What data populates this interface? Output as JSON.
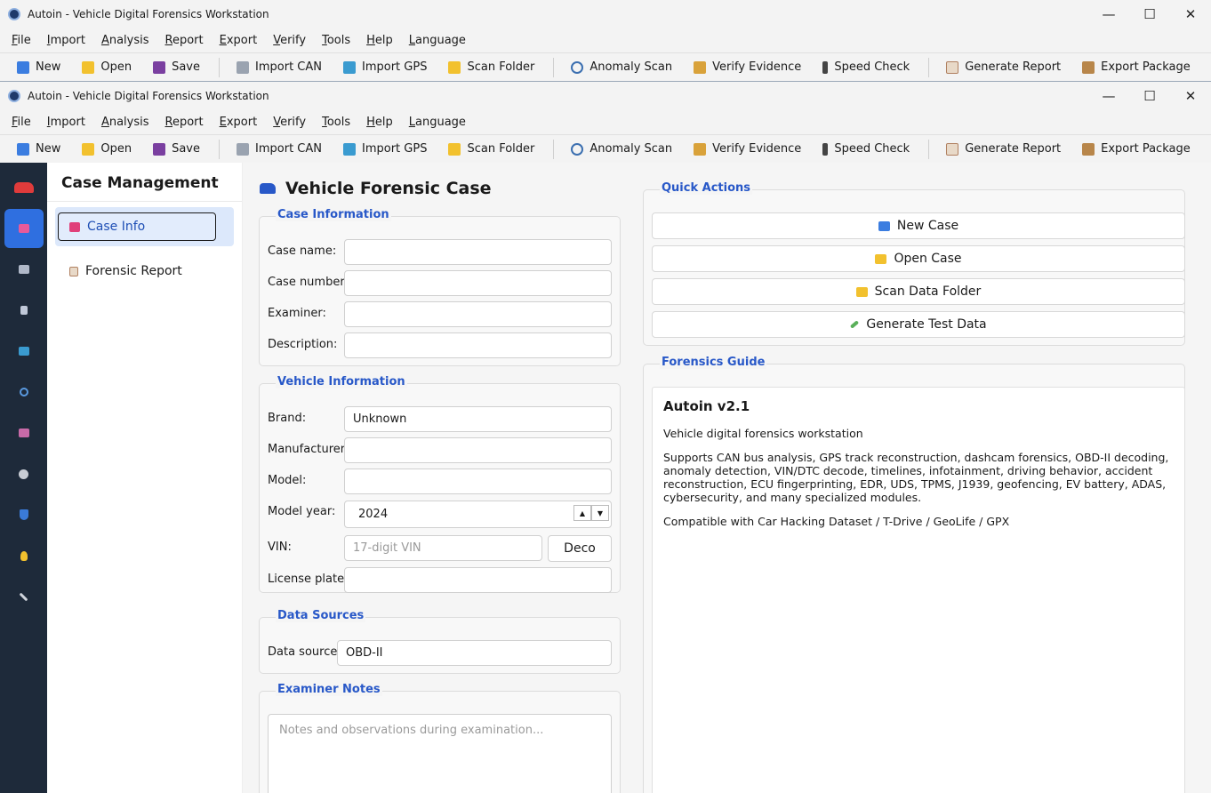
{
  "window": {
    "title": "Autoin - Vehicle Digital Forensics Workstation",
    "minimize": "—",
    "maximize": "☐",
    "close": "✕"
  },
  "menu": [
    {
      "label": "File",
      "key": "F"
    },
    {
      "label": "Import",
      "key": "I"
    },
    {
      "label": "Analysis",
      "key": "A"
    },
    {
      "label": "Report",
      "key": "R"
    },
    {
      "label": "Export",
      "key": "E"
    },
    {
      "label": "Verify",
      "key": "V"
    },
    {
      "label": "Tools",
      "key": "T"
    },
    {
      "label": "Help",
      "key": "H"
    },
    {
      "label": "Language",
      "key": "L"
    }
  ],
  "toolbar": {
    "new": "New",
    "open": "Open",
    "save": "Save",
    "import_can": "Import CAN",
    "import_gps": "Import GPS",
    "scan_folder": "Scan Folder",
    "anomaly_scan": "Anomaly Scan",
    "verify_evidence": "Verify Evidence",
    "speed_check": "Speed Check",
    "generate_report": "Generate Report",
    "export_package": "Export Package"
  },
  "colors": {
    "accent": "#2858c8",
    "rail_bg": "#1e2a3a",
    "rail_active": "#2f6fe0"
  },
  "nav": {
    "title": "Case Management",
    "items": [
      "Case Info",
      "Forensic Report"
    ]
  },
  "page": {
    "title": "Vehicle Forensic Case"
  },
  "case_info": {
    "title": "Case Information",
    "case_name_label": "Case name:",
    "case_number_label": "Case number:",
    "examiner_label": "Examiner:",
    "description_label": "Description:"
  },
  "vehicle_info": {
    "title": "Vehicle Information",
    "brand_label": "Brand:",
    "brand_value": "Unknown",
    "manufacturer_label": "Manufacturer:",
    "model_label": "Model:",
    "model_year_label": "Model year:",
    "model_year_value": "2024",
    "vin_label": "VIN:",
    "vin_placeholder": "17-digit VIN",
    "decode_label": "Deco",
    "license_label": "License plate:"
  },
  "data_sources": {
    "title": "Data Sources",
    "label": "Data source:",
    "value": "OBD-II"
  },
  "notes": {
    "title": "Examiner Notes",
    "placeholder": "Notes and observations during examination..."
  },
  "quick_actions": {
    "title": "Quick Actions",
    "new_case": "New Case",
    "open_case": "Open Case",
    "scan_data_folder": "Scan Data Folder",
    "generate_test_data": "Generate Test Data"
  },
  "guide": {
    "title": "Forensics Guide",
    "heading": "Autoin v2.1",
    "p1": "Vehicle digital forensics workstation",
    "p2": "Supports CAN bus analysis, GPS track reconstruction, dashcam forensics, OBD-II decoding, anomaly detection, VIN/DTC decode, timelines, infotainment, driving behavior, accident reconstruction, ECU fingerprinting, EDR, UDS, TPMS, J1939, geofencing, EV battery, ADAS, cybersecurity, and many specialized modules.",
    "p3": "Compatible with Car Hacking Dataset / T-Drive / GeoLife / GPX"
  }
}
